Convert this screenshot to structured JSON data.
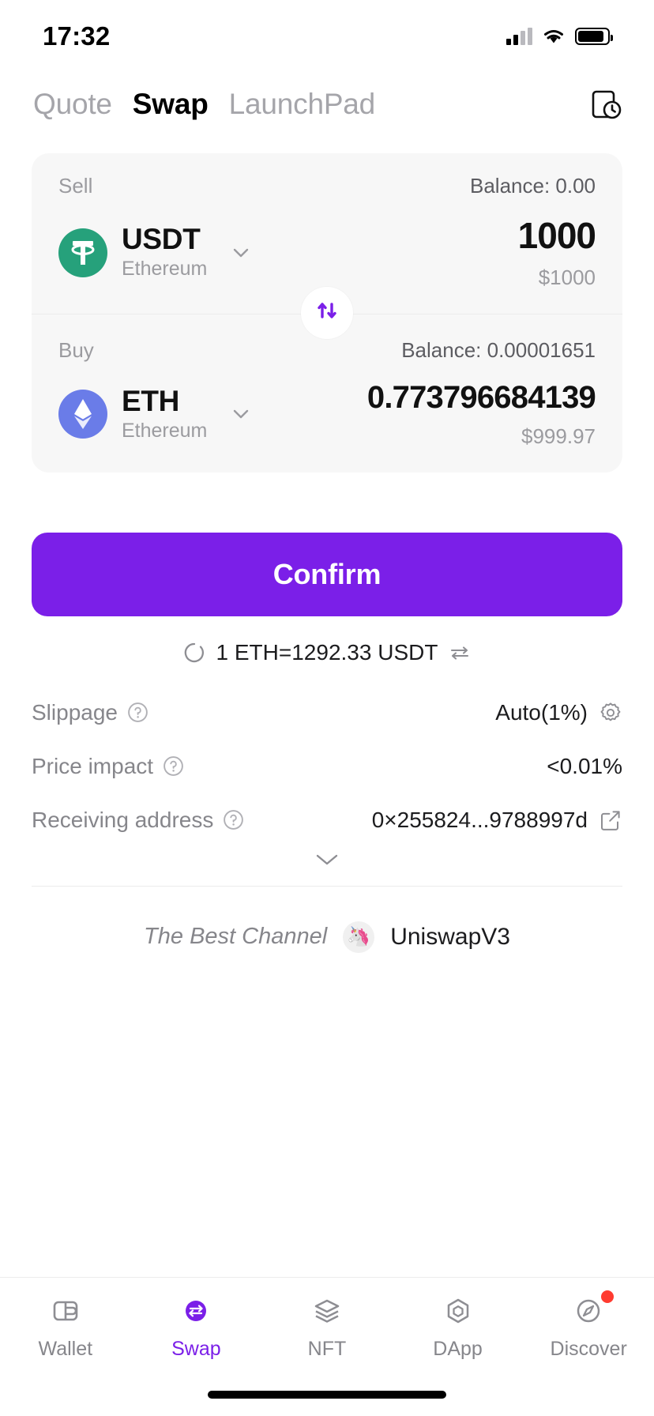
{
  "status_bar": {
    "time": "17:32",
    "cellular_icon": "cellular-signal-icon",
    "wifi_icon": "wifi-icon",
    "battery_icon": "battery-icon"
  },
  "header": {
    "tabs": [
      {
        "label": "Quote",
        "active": false
      },
      {
        "label": "Swap",
        "active": true
      },
      {
        "label": "LaunchPad",
        "active": false
      }
    ],
    "history_icon": "history-icon"
  },
  "swap": {
    "sell": {
      "label": "Sell",
      "balance": "Balance: 0.00",
      "token_symbol": "USDT",
      "token_network": "Ethereum",
      "token_icon": "usdt-icon",
      "token_color": "#26a17b",
      "amount": "1000",
      "amount_usd": "$1000"
    },
    "toggle_icon": "swap-direction-icon",
    "toggle_color": "#7B1FE8",
    "buy": {
      "label": "Buy",
      "balance": "Balance: 0.00001651",
      "token_symbol": "ETH",
      "token_network": "Ethereum",
      "token_icon": "eth-icon",
      "token_color": "#6a7ce8",
      "amount": "0.773796684139",
      "amount_usd": "$999.97"
    }
  },
  "confirm_button": {
    "label": "Confirm",
    "color": "#7B1FE8"
  },
  "rate": {
    "loading_icon": "spinner-icon",
    "text": "1 ETH=1292.33 USDT",
    "reverse_icon": "reverse-rate-icon"
  },
  "details": [
    {
      "label": "Slippage",
      "help_icon": "question-circle-icon",
      "value": "Auto(1%)",
      "trailing_icon": "gear-icon"
    },
    {
      "label": "Price impact",
      "help_icon": "question-circle-icon",
      "value": "<0.01%",
      "trailing_icon": ""
    },
    {
      "label": "Receiving address",
      "help_icon": "question-circle-icon",
      "value": "0×255824...9788997d",
      "trailing_icon": "edit-icon"
    }
  ],
  "expander_icon": "chevron-down-icon",
  "channel": {
    "label": "The Best Channel",
    "badge_icon": "unicorn-icon",
    "badge_glyph": "🦄",
    "name": "UniswapV3"
  },
  "bottom_nav": [
    {
      "label": "Wallet",
      "icon": "wallet-icon",
      "active": false,
      "badge": false
    },
    {
      "label": "Swap",
      "icon": "swap-icon",
      "active": true,
      "badge": false
    },
    {
      "label": "NFT",
      "icon": "nft-icon",
      "active": false,
      "badge": false
    },
    {
      "label": "DApp",
      "icon": "dapp-icon",
      "active": false,
      "badge": false
    },
    {
      "label": "Discover",
      "icon": "compass-icon",
      "active": false,
      "badge": true
    }
  ]
}
